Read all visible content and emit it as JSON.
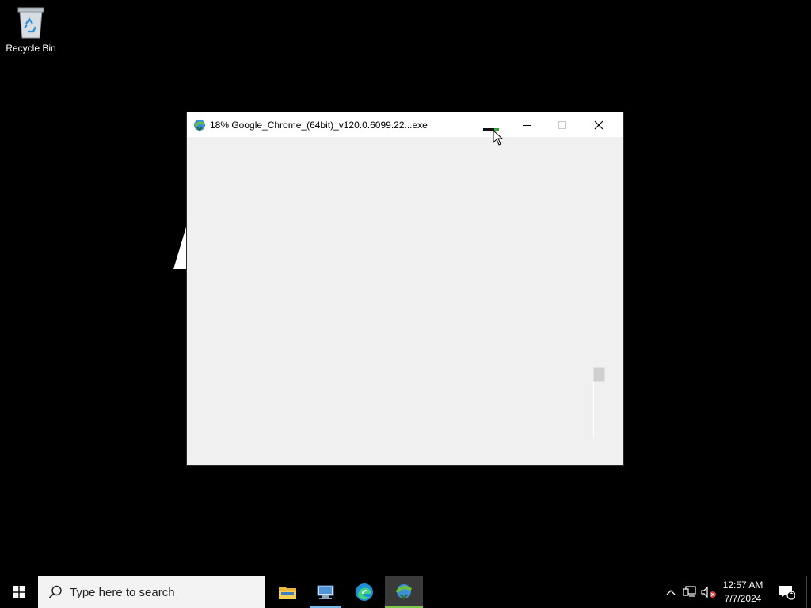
{
  "desktop": {
    "icons": [
      {
        "label": "Recycle Bin",
        "icon": "recycle-bin-icon"
      }
    ]
  },
  "window": {
    "title": "18% Google_Chrome_(64bit)_v120.0.6099.22...exe",
    "icon": "download-manager-icon",
    "progress_percent": 18,
    "controls": [
      "minimize",
      "maximize",
      "close"
    ]
  },
  "taskbar": {
    "search_placeholder": "Type here to search",
    "apps": [
      {
        "name": "File Explorer",
        "icon": "folder-icon"
      },
      {
        "name": "Network",
        "icon": "network-computer-icon"
      },
      {
        "name": "Microsoft Edge",
        "icon": "edge-icon"
      },
      {
        "name": "Download Manager",
        "icon": "download-manager-icon",
        "active": true
      }
    ],
    "clock": {
      "time": "12:57 AM",
      "date": "7/7/2024"
    },
    "notification_count": "1"
  },
  "colors": {
    "accent": "#76b9ed",
    "active_app": "#7fc94a",
    "desktop": "#000000"
  }
}
